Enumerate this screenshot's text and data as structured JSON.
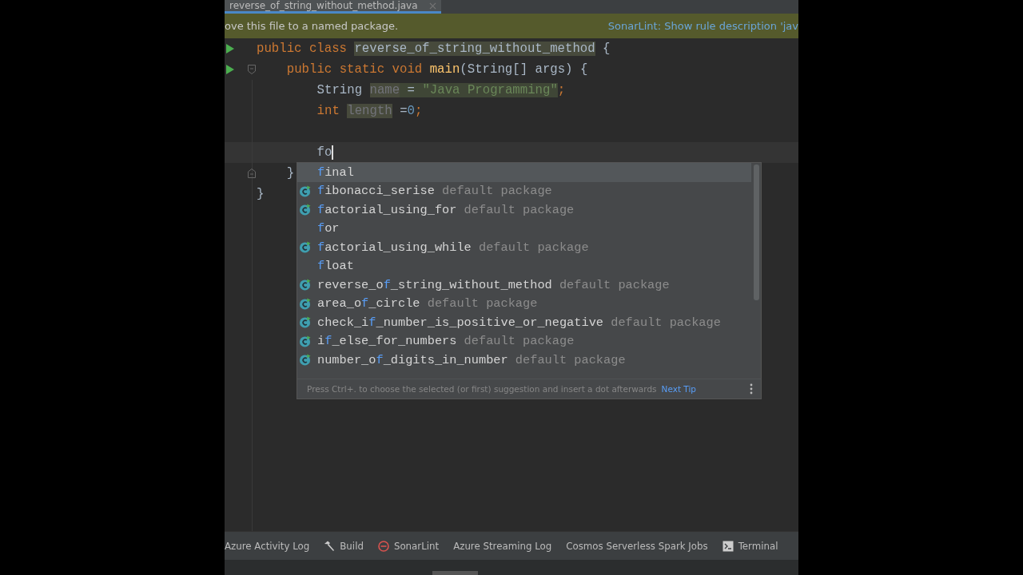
{
  "tab": {
    "label": "reverse_of_string_without_method.java",
    "selected": true
  },
  "banner": {
    "message": "ove this file to a named package.",
    "action": "SonarLint: Show rule description 'jav"
  },
  "code_lines": [
    {
      "runnable": true,
      "fold_start": false,
      "fold_end": false,
      "current": false,
      "tokens": [
        {
          "kind": "keyword",
          "text": "public class "
        },
        {
          "kind": "highlight",
          "text": "reverse_of_string_without_method"
        },
        {
          "kind": "plain",
          "text": " {"
        }
      ],
      "children": [
        {
          "runnable": true,
          "fold_start": true,
          "fold_end": false,
          "current": false,
          "tokens": [
            {
              "kind": "keyword",
              "text": "public static void "
            },
            {
              "kind": "method",
              "text": "main"
            },
            {
              "kind": "plain",
              "text": "(String[] args) {"
            }
          ],
          "children": [
            {
              "runnable": false,
              "fold_start": false,
              "fold_end": false,
              "current": false,
              "tokens": [
                {
                  "kind": "plain",
                  "text": "String "
                },
                {
                  "kind": "unused",
                  "text": "name"
                },
                {
                  "kind": "hl-plain",
                  "text": " = "
                },
                {
                  "kind": "hl-string",
                  "text": "\"Java Programming\""
                },
                {
                  "kind": "keyword",
                  "text": ";"
                }
              ]
            },
            {
              "runnable": false,
              "fold_start": false,
              "fold_end": false,
              "current": false,
              "tokens": [
                {
                  "kind": "keyword",
                  "text": "int "
                },
                {
                  "kind": "unused",
                  "text": "length"
                },
                {
                  "kind": "plain",
                  "text": " ="
                },
                {
                  "kind": "number",
                  "text": "0"
                },
                {
                  "kind": "keyword",
                  "text": ";"
                }
              ]
            },
            {
              "runnable": false,
              "fold_start": false,
              "fold_end": false,
              "current": false
            },
            {
              "runnable": false,
              "fold_start": false,
              "fold_end": false,
              "current": true,
              "tokens": [
                {
                  "kind": "plain",
                  "text": "fo"
                }
              ]
            }
          ]
        },
        {
          "runnable": false,
          "fold_start": false,
          "fold_end": true,
          "current": false,
          "tokens": [
            {
              "kind": "plain",
              "text": "}"
            }
          ]
        }
      ]
    },
    {
      "runnable": false,
      "fold_start": false,
      "fold_end": false,
      "current": false,
      "tokens": [
        {
          "kind": "plain",
          "text": "}"
        }
      ]
    }
  ],
  "completion": {
    "items": [
      {
        "kind": "keyword",
        "match": "f",
        "rest": "inal",
        "selected": true
      },
      {
        "kind": "class",
        "match": "f",
        "rest": "ibonacci_serise",
        "detail": "default package",
        "selected": false
      },
      {
        "kind": "class",
        "match": "f",
        "rest": "actorial_using_for",
        "detail": "default package",
        "selected": false
      },
      {
        "kind": "keyword",
        "match": "f",
        "rest": "or",
        "selected": false
      },
      {
        "kind": "class",
        "match": "f",
        "rest": "actorial_using_while",
        "detail": "default package",
        "selected": false
      },
      {
        "kind": "keyword",
        "match": "f",
        "rest": "loat",
        "selected": false
      },
      {
        "kind": "class",
        "prefix": "reverse_o",
        "match": "f",
        "rest": "_string_without_method",
        "detail": "default package",
        "selected": false
      },
      {
        "kind": "class",
        "prefix": "area_o",
        "match": "f",
        "rest": "_circle",
        "detail": "default package",
        "selected": false
      },
      {
        "kind": "class",
        "prefix": "check_i",
        "match": "f",
        "rest": "_number_is_positive_or_negative",
        "detail": "default package",
        "selected": false
      },
      {
        "kind": "class",
        "prefix": "i",
        "match": "f",
        "rest": "_else_for_numbers",
        "detail": "default package",
        "selected": false
      },
      {
        "kind": "class",
        "prefix": "number_o",
        "match": "f",
        "rest": "_digits_in_number",
        "detail": "default package",
        "selected": false
      }
    ],
    "hint": "Press Ctrl+. to choose the selected (or first) suggestion and insert a dot afterwards",
    "hint_link": "Next Tip"
  },
  "tool_windows": [
    {
      "kind": "log",
      "label": "Azure Activity Log"
    },
    {
      "kind": "build",
      "label": "Build"
    },
    {
      "kind": "lint",
      "label": "SonarLint"
    },
    {
      "kind": "log",
      "label": "Azure Streaming Log"
    },
    {
      "kind": "log",
      "label": "Cosmos Serverless Spark Jobs"
    },
    {
      "kind": "terminal",
      "label": "Terminal"
    }
  ]
}
